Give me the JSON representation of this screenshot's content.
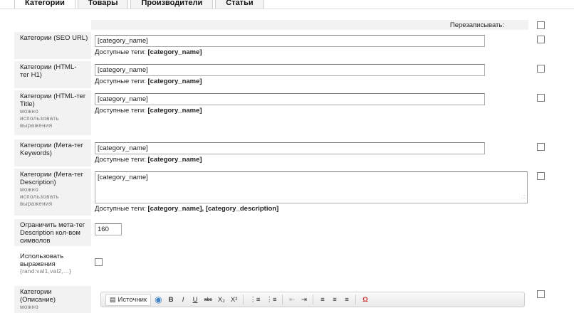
{
  "tabs": [
    {
      "label": "Категории",
      "active": true
    },
    {
      "label": "Товары",
      "active": false
    },
    {
      "label": "Производители",
      "active": false
    },
    {
      "label": "Статьи",
      "active": false
    }
  ],
  "header": {
    "rewrite_label": "Перезаписывать:"
  },
  "fields": [
    {
      "label": "Категории (SEO URL)",
      "hint": "",
      "value": "[category_name]",
      "avail_prefix": "Доступные теги:",
      "avail_tags": "[category_name]"
    },
    {
      "label": "Категории (HTML-тег H1)",
      "hint": "",
      "value": "[category_name]",
      "avail_prefix": "Доступные теги:",
      "avail_tags": "[category_name]"
    },
    {
      "label": "Категории (HTML-тег Title)",
      "hint": "можно использовать выражения",
      "value": "[category_name]",
      "avail_prefix": "Доступные теги:",
      "avail_tags": "[category_name]"
    },
    {
      "label": "Категории (Мета-тег Keywords)",
      "hint": "",
      "value": "[category_name]",
      "avail_prefix": "Доступные теги:",
      "avail_tags": "[category_name]"
    },
    {
      "label": "Категории (Мета-тег Description)",
      "hint": "можно использовать выражения",
      "value": "[category_name]",
      "avail_prefix": "Доступные теги:",
      "avail_tags": "[category_name], [category_description]"
    }
  ],
  "limit": {
    "label": "Ограничить мета-тег Description кол-вом символов",
    "value": "160"
  },
  "expressions": {
    "label": "Использовать выражения",
    "hint": "{rand:val1,val2,...}"
  },
  "description": {
    "label": "Категории (Описание)",
    "hint": "можно"
  },
  "editor": {
    "source_label": "Источник",
    "buttons": [
      "B",
      "I",
      "U",
      "abc",
      "X₂",
      "X²",
      "⋮≡",
      "⋮≡",
      "⇤",
      "⇥",
      "≡",
      "≡",
      "≡",
      "Ω"
    ]
  }
}
